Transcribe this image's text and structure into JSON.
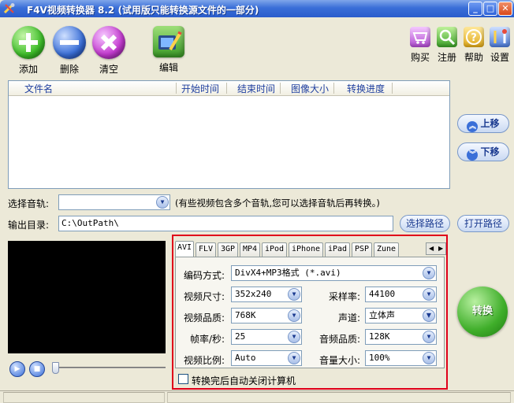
{
  "window": {
    "title": "F4V视频转换器 8.2 (试用版只能转换源文件的一部分)",
    "minimize_symbol": "_",
    "maximize_symbol": "□",
    "close_symbol": "✕"
  },
  "toolbar": {
    "add_label": "添加",
    "remove_label": "删除",
    "clear_label": "清空",
    "edit_label": "编辑",
    "buy_label": "购买",
    "register_label": "注册",
    "help_label": "帮助",
    "settings_label": "设置"
  },
  "file_list": {
    "columns": [
      "文件名",
      "开始时间",
      "结束时间",
      "图像大小",
      "转换进度"
    ]
  },
  "side_buttons": {
    "move_up_label": "上移",
    "move_down_label": "下移"
  },
  "audio_track": {
    "label": "选择音轨:",
    "value": "",
    "hint": "(有些视频包含多个音轨,您可以选择音轨后再转换。)"
  },
  "output": {
    "label": "输出目录:",
    "path": "C:\\OutPath\\",
    "choose_path_label": "选择路径",
    "open_path_label": "打开路径"
  },
  "format_tabs": [
    "AVI",
    "FLV",
    "3GP",
    "MP4",
    "iPod",
    "iPhone",
    "iPad",
    "PSP",
    "Zune"
  ],
  "active_tab": "AVI",
  "settings": {
    "codec_label": "编码方式:",
    "codec_value": "DivX4+MP3格式 (*.avi)",
    "video_size_label": "视频尺寸:",
    "video_size_value": "352x240",
    "sample_rate_label": "采样率:",
    "sample_rate_value": "44100",
    "video_quality_label": "视频品质:",
    "video_quality_value": "768K",
    "channel_label": "声道:",
    "channel_value": "立体声",
    "frame_rate_label": "帧率/秒:",
    "frame_rate_value": "25",
    "audio_quality_label": "音频品质:",
    "audio_quality_value": "128K",
    "aspect_label": "视频比例:",
    "aspect_value": "Auto",
    "volume_label": "音量大小:",
    "volume_value": "100%",
    "shutdown_label": "转换完后自动关闭计算机",
    "shutdown_checked": false
  },
  "convert_label": "转换",
  "player": {
    "play_symbol": "▶",
    "stop_symbol": "■",
    "position": 0
  },
  "colors": {
    "title_bar": "#2a5ccc",
    "highlight_frame": "#e0001a",
    "convert_button": "#3fae2a",
    "add_button": "#3fbf2a",
    "remove_button": "#3a6fd8",
    "clear_button": "#c43ad0"
  },
  "icons": {
    "app": "app-tools-icon",
    "add": "plus-icon",
    "remove": "minus-icon",
    "clear": "x-icon",
    "edit": "edit-film-icon",
    "buy": "cart-icon",
    "register": "magnifier-icon",
    "help": "question-icon",
    "settings": "tools-icon",
    "move_up": "double-chevron-up-icon",
    "move_down": "double-chevron-down-icon"
  }
}
